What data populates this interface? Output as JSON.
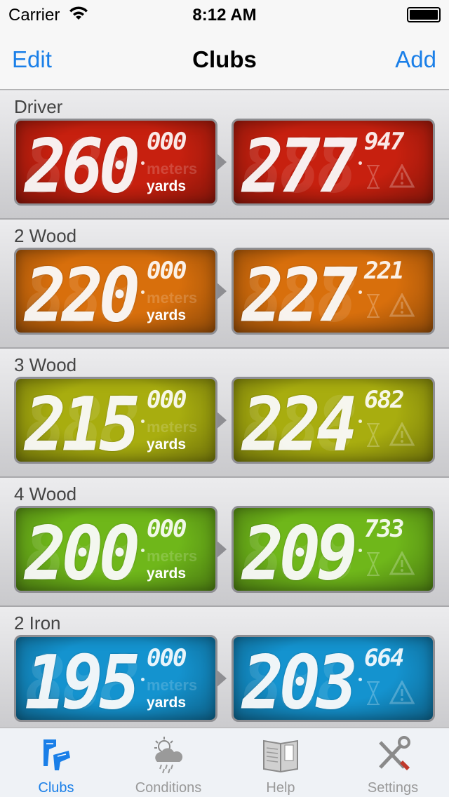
{
  "status_bar": {
    "carrier": "Carrier",
    "time": "8:12 AM"
  },
  "nav": {
    "edit_label": "Edit",
    "title": "Clubs",
    "add_label": "Add"
  },
  "units": {
    "meters": "meters",
    "yards": "yards"
  },
  "clubs": [
    {
      "name": "Driver",
      "left_big": "260",
      "left_small": "000",
      "right_big": "277",
      "right_small": "947",
      "color": "#c7200f"
    },
    {
      "name": "2 Wood",
      "left_big": "220",
      "left_small": "000",
      "right_big": "227",
      "right_small": "221",
      "color": "#d86f0c"
    },
    {
      "name": "3 Wood",
      "left_big": "215",
      "left_small": "000",
      "right_big": "224",
      "right_small": "682",
      "color": "#a8ad0f"
    },
    {
      "name": "4 Wood",
      "left_big": "200",
      "left_small": "000",
      "right_big": "209",
      "right_small": "733",
      "color": "#6fb71a"
    },
    {
      "name": "2 Iron",
      "left_big": "195",
      "left_small": "000",
      "right_big": "203",
      "right_small": "664",
      "color": "#1493cf"
    }
  ],
  "tabs": [
    {
      "label": "Clubs",
      "icon": "golf-clubs-icon",
      "active": true
    },
    {
      "label": "Conditions",
      "icon": "weather-icon",
      "active": false
    },
    {
      "label": "Help",
      "icon": "book-icon",
      "active": false
    },
    {
      "label": "Settings",
      "icon": "tools-icon",
      "active": false
    }
  ]
}
